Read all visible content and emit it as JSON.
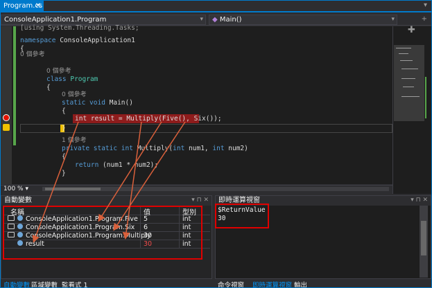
{
  "tab": {
    "label": "Program.cs",
    "close": "✕"
  },
  "nav": {
    "left": "ConsoleApplication1.Program",
    "right": "Main()"
  },
  "code": {
    "l1": "[using System.Threading.Tasks;",
    "l2_kw": "namespace",
    "l2_rest": " ConsoleApplication1",
    "l3": "{",
    "lens0": "0 個參考",
    "lens0b": "0 個參考",
    "l5_kw": "class",
    "l5_ty": "Program",
    "l6": "{",
    "lens1": "0 個參考",
    "l8_kw": "static void",
    "l8_rest": " Main()",
    "l9": "{",
    "l10": "int result = Multiply(Five(), Six());",
    "l11": "}",
    "lens2": "1 個參考",
    "l13_kw": "private static int",
    "l13_rest": " Multiply(",
    "l13_kw2": "int",
    "l13_rest2": " num1, ",
    "l13_kw3": "int",
    "l13_rest3": " num2)",
    "l14": "{",
    "l15_kw": "return",
    "l15_rest": " (num1 * num2);",
    "l16": "}"
  },
  "zoom": "100 %",
  "autos": {
    "title": "自動變數",
    "pane_buttons": "▾ ⊓ ✕",
    "headers": {
      "name": "名稱",
      "value": "值",
      "type": "型別"
    },
    "rows": [
      {
        "name": "ConsoleApplication1.Program.Five",
        "value": "5",
        "type": "int"
      },
      {
        "name": "ConsoleApplication1.Program.Six",
        "value": "6",
        "type": "int"
      },
      {
        "name": "ConsoleApplication1.Program.Multiply",
        "value": "30",
        "type": "int"
      },
      {
        "name": "result",
        "value": "30",
        "type": "int"
      }
    ],
    "tabs": [
      "自動變數",
      "區域變數",
      "監看式 1"
    ]
  },
  "immediate": {
    "title": "即時運算視窗",
    "pane_buttons": "▾ ⊓ ✕",
    "lines": [
      "$ReturnValue",
      "30"
    ],
    "tabs": [
      "命令視窗",
      "即時運算視窗",
      "輸出"
    ]
  },
  "colors": {
    "accent": "#007acc",
    "annotation": "#e00000",
    "breakpoint": "#e51400"
  }
}
